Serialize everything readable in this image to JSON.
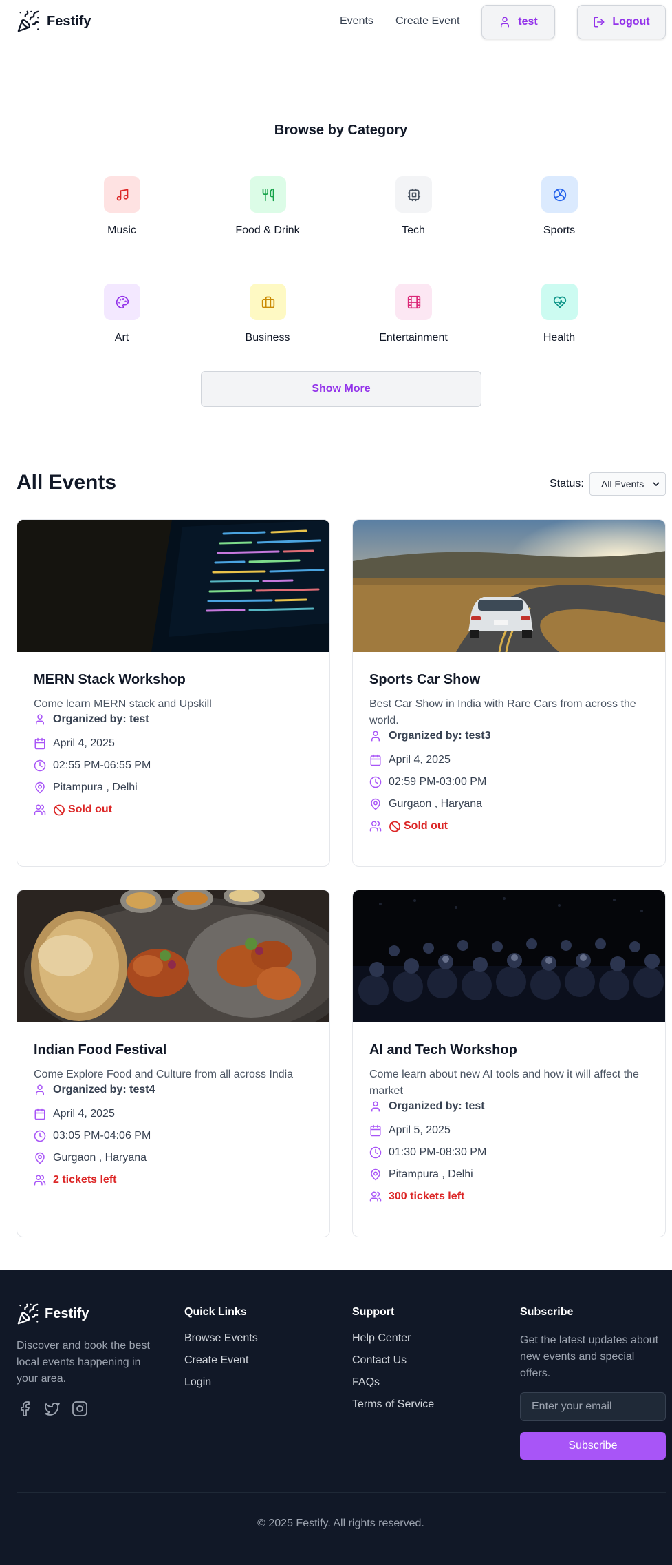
{
  "header": {
    "brand": "Festify",
    "nav": {
      "events": "Events",
      "create_event": "Create Event"
    },
    "user_button": "test",
    "logout_button": "Logout"
  },
  "categories": {
    "title": "Browse by Category",
    "items": [
      {
        "label": "Music",
        "icon": "music-icon",
        "bg": "#fee2e2",
        "color": "#dc2626"
      },
      {
        "label": "Food & Drink",
        "icon": "utensils-icon",
        "bg": "#dcfce7",
        "color": "#16a34a"
      },
      {
        "label": "Tech",
        "icon": "cpu-icon",
        "bg": "#f3f4f6",
        "color": "#4b5563"
      },
      {
        "label": "Sports",
        "icon": "volleyball-icon",
        "bg": "#dbeafe",
        "color": "#2563eb"
      },
      {
        "label": "Art",
        "icon": "palette-icon",
        "bg": "#f3e8ff",
        "color": "#9333ea"
      },
      {
        "label": "Business",
        "icon": "briefcase-icon",
        "bg": "#fef9c3",
        "color": "#ca8a04"
      },
      {
        "label": "Entertainment",
        "icon": "film-icon",
        "bg": "#fce7f3",
        "color": "#db2777"
      },
      {
        "label": "Health",
        "icon": "heart-pulse-icon",
        "bg": "#ccfbf1",
        "color": "#0d9488"
      }
    ],
    "show_more": "Show More"
  },
  "events_section": {
    "title": "All Events",
    "status_label": "Status:",
    "status_selected": "All Events"
  },
  "events": [
    {
      "title": "MERN Stack Workshop",
      "description": "Come learn MERN stack and Upskill",
      "organizer": "Organized by: test",
      "date": "April 4, 2025",
      "time": "02:55 PM-06:55 PM",
      "location": "Pitampura , Delhi",
      "availability": "Sold out",
      "sold_out": true
    },
    {
      "title": "Sports Car Show",
      "description": "Best Car Show in India with Rare Cars from across the world.",
      "organizer": "Organized by: test3",
      "date": "April 4, 2025",
      "time": "02:59 PM-03:00 PM",
      "location": "Gurgaon , Haryana",
      "availability": "Sold out",
      "sold_out": true
    },
    {
      "title": "Indian Food Festival",
      "description": "Come Explore Food and Culture from all across India",
      "organizer": "Organized by: test4",
      "date": "April 4, 2025",
      "time": "03:05 PM-04:06 PM",
      "location": "Gurgaon , Haryana",
      "availability": "2 tickets left",
      "sold_out": false
    },
    {
      "title": "AI and Tech Workshop",
      "description": "Come learn about new AI tools and how it will affect the market",
      "organizer": "Organized by: test",
      "date": "April 5, 2025",
      "time": "01:30 PM-08:30 PM",
      "location": "Pitampura , Delhi",
      "availability": "300 tickets left",
      "sold_out": false
    }
  ],
  "footer": {
    "brand": "Festify",
    "about": "Discover and book the best local events happening in your area.",
    "socials": [
      "facebook-icon",
      "twitter-icon",
      "instagram-icon"
    ],
    "quick_links": {
      "title": "Quick Links",
      "items": [
        "Browse Events",
        "Create Event",
        "Login"
      ]
    },
    "support": {
      "title": "Support",
      "items": [
        "Help Center",
        "Contact Us",
        "FAQs",
        "Terms of Service"
      ]
    },
    "subscribe": {
      "title": "Subscribe",
      "text": "Get the latest updates about new events and special offers.",
      "placeholder": "Enter your email",
      "button": "Subscribe"
    },
    "copyright": "© 2025 Festify. All rights reserved."
  },
  "colors": {
    "accent": "#9333ea",
    "accent_button": "#a855f7",
    "danger": "#dc2626",
    "footer_bg": "#111827"
  }
}
